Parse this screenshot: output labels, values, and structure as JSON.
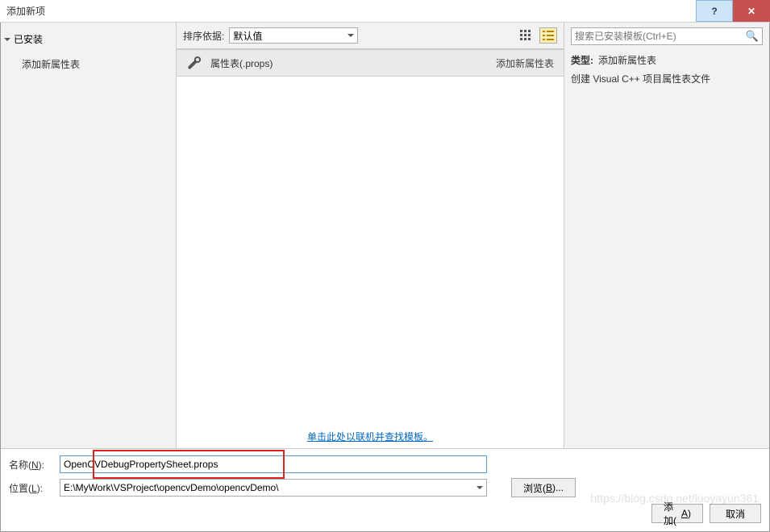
{
  "window": {
    "title": "添加新项"
  },
  "left": {
    "installed_label": "已安装",
    "nodes": [
      "添加新属性表"
    ]
  },
  "sort": {
    "label": "排序依据:",
    "value": "默认值"
  },
  "templates": {
    "items": [
      {
        "name": "属性表(.props)",
        "category": "添加新属性表",
        "selected": true
      }
    ],
    "online_link": "单击此处以联机并查找模板。"
  },
  "right": {
    "search_placeholder": "搜索已安装模板(Ctrl+E)",
    "type_label": "类型:",
    "type_value": "添加新属性表",
    "description": "创建 Visual C++ 项目属性表文件"
  },
  "bottom": {
    "name_label": "名称(",
    "name_key": "N",
    "name_value": "OpenCVDebugPropertySheet.props",
    "loc_label": "位置(",
    "loc_key": "L",
    "loc_value": "E:\\MyWork\\VSProject\\opencvDemo\\opencvDemo\\",
    "browse_label": "浏览(",
    "browse_key": "B",
    "add_label": "添加(",
    "add_key": "A",
    "cancel_label": "取消",
    "close_paren": "):",
    "btn_close": ")...",
    "btn_close2": ")"
  },
  "watermark": "https://blog.csdn.net/luoyayun361"
}
